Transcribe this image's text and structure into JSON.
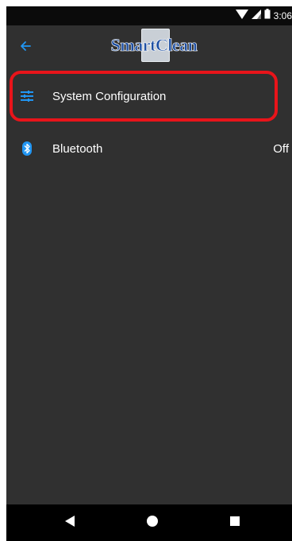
{
  "status_bar": {
    "time": "3:06",
    "icons": [
      "wifi-icon",
      "signal-icon",
      "battery-icon"
    ]
  },
  "app_bar": {
    "back_icon": "arrow-back-icon",
    "logo_text": "SmartClean"
  },
  "settings": {
    "items": [
      {
        "label": "System Configuration",
        "icon": "sliders-icon",
        "value": ""
      },
      {
        "label": "Bluetooth",
        "icon": "bluetooth-icon",
        "value": "Off"
      }
    ]
  },
  "nav_bar": {
    "icons": [
      "back-triangle-icon",
      "home-circle-icon",
      "recents-square-icon"
    ]
  },
  "colors": {
    "accent": "#2196f3",
    "background": "#303030",
    "highlight": "#e8141a",
    "logo": "#1d4fa3"
  }
}
